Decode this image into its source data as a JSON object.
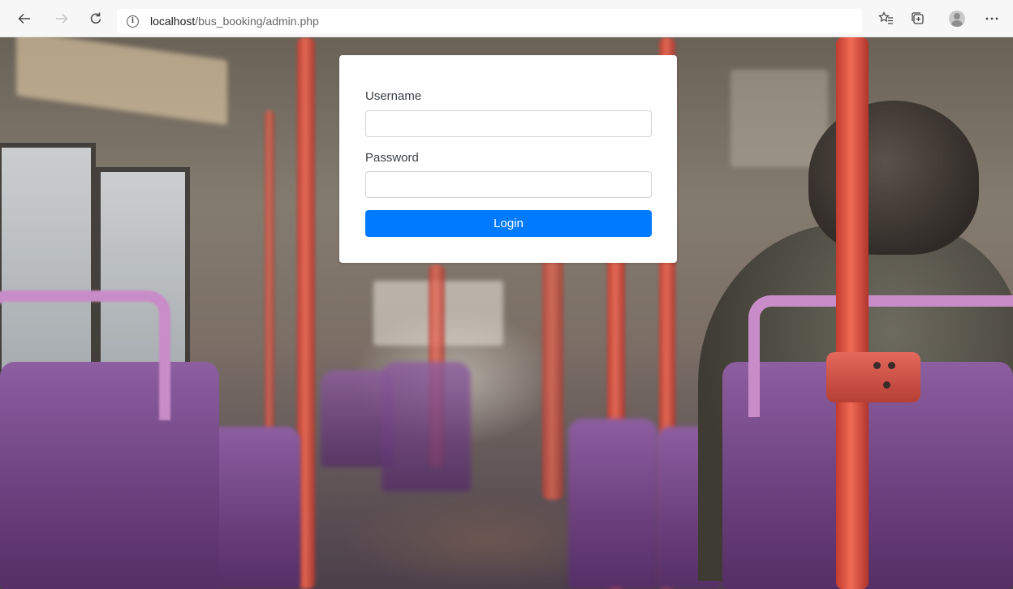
{
  "browser": {
    "url_host": "localhost",
    "url_path": "/bus_booking/admin.php"
  },
  "login_form": {
    "username_label": "Username",
    "username_value": "",
    "password_label": "Password",
    "password_value": "",
    "login_button": "Login"
  },
  "colors": {
    "primary_button": "#007bff"
  }
}
